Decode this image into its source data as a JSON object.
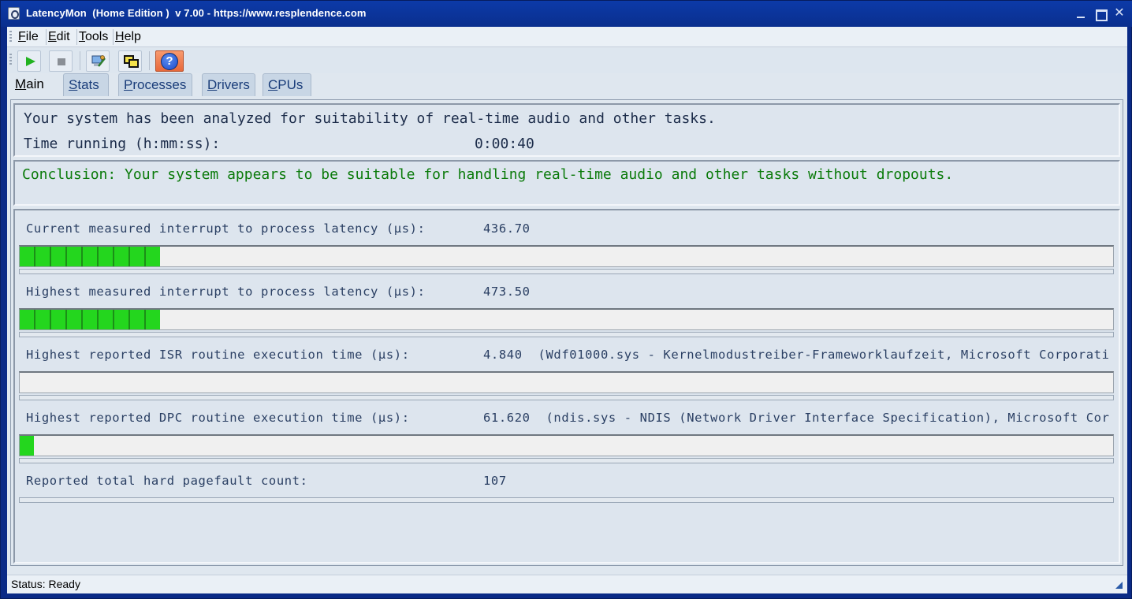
{
  "window": {
    "title": "LatencyMon  (Home Edition )  v 7.00 - https://www.resplendence.com"
  },
  "menu": {
    "file": {
      "u": "F",
      "rest": "ile"
    },
    "edit": {
      "u": "E",
      "rest": "dit"
    },
    "tools": {
      "u": "T",
      "rest": "ools"
    },
    "help": {
      "u": "H",
      "rest": "elp"
    }
  },
  "toolbar": {
    "help_glyph": "?"
  },
  "tabs": [
    {
      "u": "M",
      "rest": "ain"
    },
    {
      "u": "S",
      "rest": "tats"
    },
    {
      "u": "P",
      "rest": "rocesses"
    },
    {
      "u": "D",
      "rest": "rivers"
    },
    {
      "u": "C",
      "rest": "PUs"
    }
  ],
  "summary": {
    "analyzed": "Your system has been analyzed for suitability of real-time audio and other tasks.",
    "time_label": "Time running (h:mm:ss):",
    "time_value": "0:00:40",
    "conclusion": "Conclusion: Your system appears to be suitable for handling real-time audio and other tasks without dropouts."
  },
  "metrics": [
    {
      "label": "Current measured interrupt to process latency (µs):",
      "value": "436.70",
      "fill_fraction": 0.128
    },
    {
      "label": "Highest measured interrupt to process latency (µs):",
      "value": "473.50",
      "fill_fraction": 0.128
    },
    {
      "label": "Highest reported ISR routine execution time (µs):",
      "value": "4.840  (Wdf01000.sys - Kernelmodustreiber-Frameworklaufzeit, Microsoft Corporati",
      "fill_fraction": 0
    },
    {
      "label": "Highest reported DPC routine execution time (µs):",
      "value": "61.620  (ndis.sys - NDIS (Network Driver Interface Specification), Microsoft Cor",
      "fill_fraction": 0.013
    },
    {
      "label": "Reported total hard pagefault count:",
      "value": "107"
    }
  ],
  "status": {
    "text": "Status: Ready"
  },
  "colors": {
    "title_bar": "#0a2f8e",
    "conclusion_text": "#0a7a0a",
    "bar_fill": "#24d61e"
  }
}
